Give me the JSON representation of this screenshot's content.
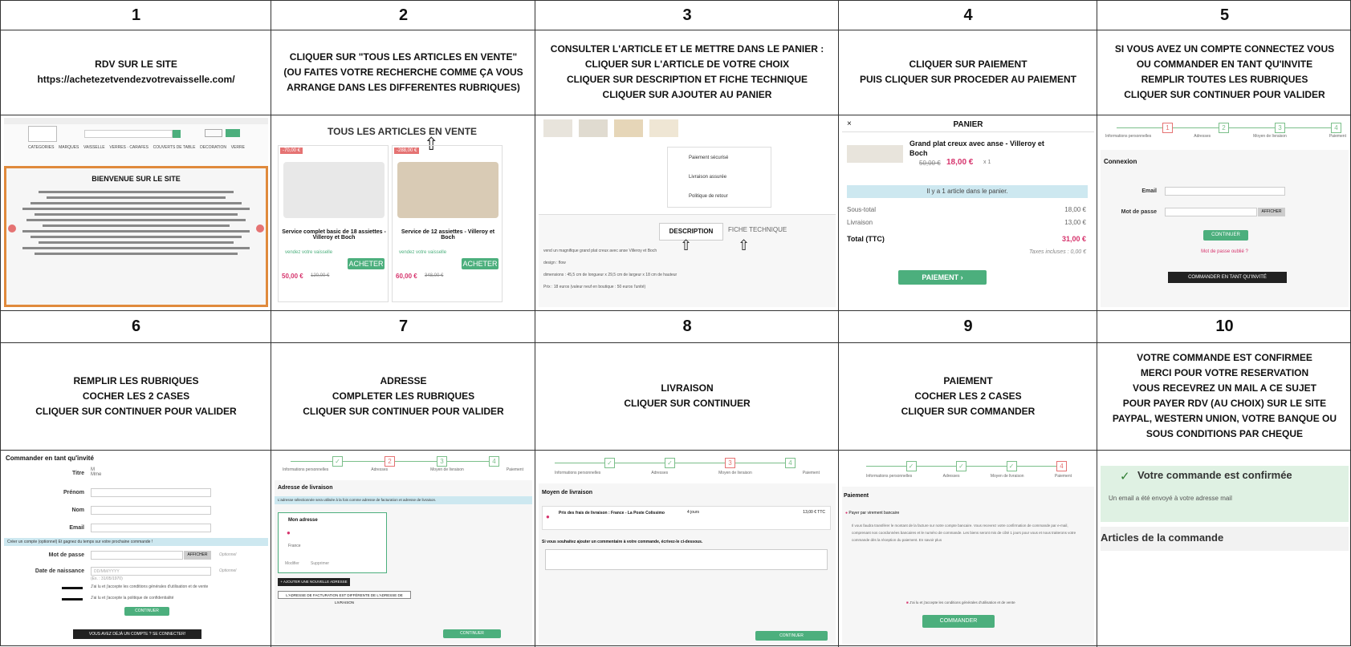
{
  "steps": [
    {
      "num": "1",
      "text": "RDV SUR LE SITE\nhttps://achetezetvendezvotrevaisselle.com/"
    },
    {
      "num": "2",
      "text": "CLIQUER SUR \"TOUS LES ARTICLES EN VENTE\"\n(OU FAITES VOTRE RECHERCHE COMME ÇA VOUS\nARRANGE DANS LES DIFFERENTES RUBRIQUES)"
    },
    {
      "num": "3",
      "text": "CONSULTER L'ARTICLE ET LE METTRE DANS LE PANIER :\nCLIQUER SUR L'ARTICLE DE VOTRE CHOIX\nCLIQUER SUR DESCRIPTION ET FICHE TECHNIQUE\nCLIQUER SUR AJOUTER AU PANIER"
    },
    {
      "num": "4",
      "text": "CLIQUER SUR PAIEMENT\nPUIS CLIQUER SUR PROCEDER AU PAIEMENT"
    },
    {
      "num": "5",
      "text": "SI VOUS AVEZ UN COMPTE CONNECTEZ VOUS\nOU COMMANDER EN TANT QU'INVITE\nREMPLIR TOUTES LES RUBRIQUES\nCLIQUER SUR CONTINUER POUR VALIDER"
    },
    {
      "num": "6",
      "text": "REMPLIR LES RUBRIQUES\nCOCHER LES 2 CASES\nCLIQUER SUR CONTINUER POUR VALIDER"
    },
    {
      "num": "7",
      "text": "ADRESSE\nCOMPLETER LES RUBRIQUES\nCLIQUER SUR CONTINUER POUR VALIDER"
    },
    {
      "num": "8",
      "text": "LIVRAISON\nCLIQUER SUR CONTINUER"
    },
    {
      "num": "9",
      "text": "PAIEMENT\nCOCHER LES 2 CASES\nCLIQUER SUR COMMANDER"
    },
    {
      "num": "10",
      "text": "VOTRE COMMANDE EST CONFIRMEE\nMERCI POUR VOTRE RESERVATION\nVOUS RECEVREZ UN MAIL A CE SUJET\nPOUR PAYER RDV (AU CHOIX) SUR LE SITE\nPAYPAL, WESTERN UNION, VOTRE BANQUE OU\nSOUS CONDITIONS PAR CHEQUE"
    }
  ],
  "shot1": {
    "welcome": "BIENVENUE SUR LE SITE",
    "nav": [
      "CATEGORIES",
      "MARQUES",
      "VAISSELLE",
      "VERRES · CARAFES",
      "COUVERTS DE TABLE",
      "DECORATION",
      "VERRE"
    ]
  },
  "shot2": {
    "title": "TOUS LES ARTICLES EN VENTE",
    "p1_badge": "-70,00 €",
    "p1_name": "Service complet basic de 18 assiettes - Villeroy et Boch",
    "p1_seller": "vendez votre vaisselle",
    "p1_price": "50,00 €",
    "p1_old": "120,00 €",
    "p2_badge": "-288,00 €",
    "p2_name": "Service de 12 assiettes - Villeroy et Boch",
    "p2_seller": "vendez votre vaisselle",
    "p2_price": "60,00 €",
    "p2_old": "348,00 €",
    "buy": "ACHETER"
  },
  "shot3": {
    "secure": "Paiement sécurisé",
    "delivery": "Livraison assurée",
    "returns": "Politique de retour",
    "tab_desc": "DESCRIPTION",
    "tab_tech": "FICHE TECHNIQUE",
    "d1": "vend un magnifique grand plat creux avec anse Villeroy et Boch",
    "d2": "design : flow",
    "d3": "dimensions : 45,5 cm de longueur x 29,5 cm de largeur x 18 cm de hauteur",
    "d4": "Prix : 18 euros (valeur neuf en boutique : 50 euros l'unité)"
  },
  "shot4": {
    "title": "PANIER",
    "item": "Grand plat creux avec anse - Villeroy et Boch",
    "old": "50,00 €",
    "price": "18,00 €",
    "qty": "x 1",
    "info": "Il y a 1 article dans le panier.",
    "subtotal_l": "Sous-total",
    "subtotal_v": "18,00 €",
    "ship_l": "Livraison",
    "ship_v": "13,00 €",
    "total_l": "Total (TTC)",
    "total_v": "31,00 €",
    "tax": "Taxes incluses : 0,00 €",
    "pay": "PAIEMENT ›"
  },
  "stepper": {
    "s1": "Informations personnelles",
    "s2": "Adresses",
    "s3": "Moyen de livraison",
    "s4": "Paiement"
  },
  "shot5": {
    "conn": "Connexion",
    "email": "Email",
    "pwd": "Mot de passe",
    "show": "AFFICHER",
    "cont": "CONTINUER",
    "forgot": "Mot de passe oublié ?",
    "guest": "COMMANDER EN TANT QU'INVITÉ"
  },
  "shot6": {
    "title": "Commander en tant qu'invité",
    "titre": "Titre",
    "m": "M",
    "mme": "Mme",
    "prenom": "Prénom",
    "nom": "Nom",
    "email": "Email",
    "create": "Créer un compte (optionnel) Et gagnez du temps sur votre prochaine commande !",
    "pwd": "Mot de passe",
    "show": "AFFICHER",
    "opt": "Optionnel",
    "dob": "Date de naissance",
    "dob_ph": "DD/MM/YYYY",
    "dob_ex": "(Ex. : 31/05/1970)",
    "cgu": "J'ai lu et j'accepte les conditions générales d'utilisation et de vente",
    "privacy": "J'ai lu et j'accepte la politique de confidentialité",
    "cont": "CONTINUER",
    "login": "VOUS AVEZ DÉJÀ UN COMPTE ? SE CONNECTER!"
  },
  "shot7": {
    "title": "Adresse de livraison",
    "info": "L'adresse sélectionnée sera utilisée à la fois comme adresse de facturation et adresse de livraison.",
    "addr": "Mon adresse",
    "country": "France",
    "edit": "Modifier",
    "del": "Supprimer",
    "add": "+ AJOUTER UNE NOUVELLE ADRESSE",
    "diff": "L'ADRESSE DE FACTURATION EST DIFFÉRENTE DE L'ADRESSE DE LIVRAISON",
    "cont": "CONTINUER"
  },
  "shot8": {
    "title": "Moyen de livraison",
    "carrier": "Prix des frais de livraison : France - La Poste Colissimo",
    "days": "4 jours",
    "price": "13,00 € TTC",
    "comment": "Si vous souhaitez ajouter un commentaire à votre commande, écrivez-le ci-dessous.",
    "cont": "CONTINUER"
  },
  "shot9": {
    "title": "Paiement",
    "method": "Payer par virement bancaire",
    "desc": "Il vous faudra transférer le montant de la facture sur notre compte bancaire. Vous recevrez votre confirmation de commande par e-mail, comprenant nos coordonnées bancaires et le numéro de commande. Les biens seront mis de côté 1 jours pour vous et nous traiterons votre commande dès la réception du paiement. En savoir plus",
    "cgu": "J'ai lu et j'accepte les conditions générales d'utilisation et de vente",
    "order": "COMMANDER"
  },
  "shot10": {
    "confirm": "Votre commande est confirmée",
    "mail": "Un email a été envoyé à votre adresse mail",
    "items": "Articles de la commande"
  }
}
